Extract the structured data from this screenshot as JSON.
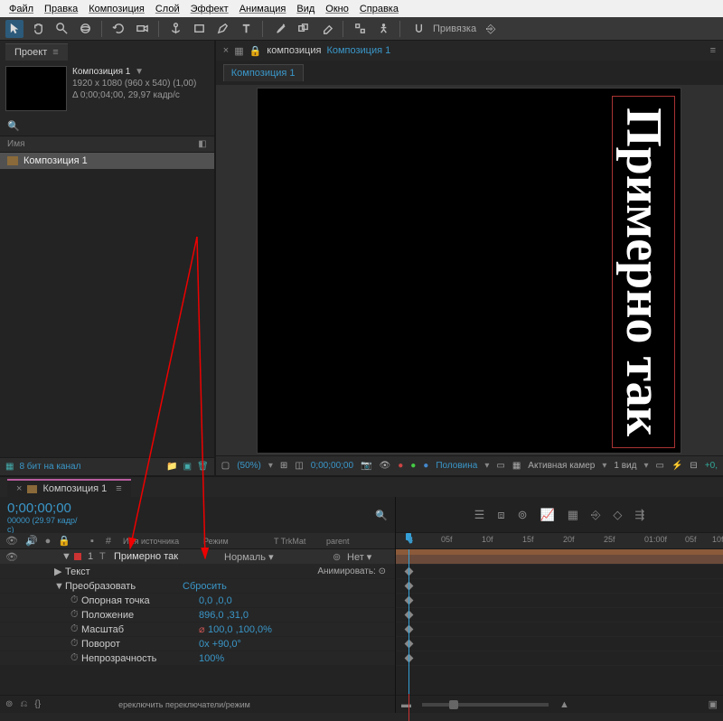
{
  "menu": [
    "Файл",
    "Правка",
    "Композиция",
    "Слой",
    "Эффект",
    "Анимация",
    "Вид",
    "Окно",
    "Справка"
  ],
  "toolbar_snap_label": "Привязка",
  "project": {
    "tab_label": "Проект",
    "comp_name": "Композиция 1",
    "comp_dims": "1920 x 1080  (960 x 540) (1,00)",
    "comp_dur": "Δ 0;00;04;00, 29,97 кадр/с",
    "name_header": "Имя",
    "items": [
      "Композиция 1"
    ],
    "footer_bits": "8 бит на канал"
  },
  "viewer": {
    "nav_label_crumb": "композиция",
    "nav_label_active": "Композиция 1",
    "subtab": "Композиция 1",
    "canvas_text": "Примерно так",
    "status": {
      "zoom": "(50%)",
      "time": "0;00;00;00",
      "res": "Половина",
      "cam": "Активная камер",
      "view": "1 вид"
    }
  },
  "timeline": {
    "tab_label": "Композиция 1",
    "time": "0;00;00;00",
    "frame_info": "00000 (29.97 кадр/с)",
    "col_idx": "#",
    "col_name": "Имя источника",
    "col_mode": "Режим",
    "col_trk": "T  TrkMat",
    "col_par": "parent",
    "layer": {
      "index": "1",
      "name": "Примерно так",
      "mode": "Нормаль",
      "parent": "Нет"
    },
    "text_group": "Текст",
    "animate_label": "Анимировать:",
    "transform_group": "Преобразовать",
    "transform_reset": "Сбросить",
    "props": [
      {
        "name": "Опорная точка",
        "val": "0,0 ,0,0"
      },
      {
        "name": "Положение",
        "val": "896,0 ,31,0"
      },
      {
        "name": "Масштаб",
        "val": "100,0 ,100,0%",
        "link": true
      },
      {
        "name": "Поворот",
        "val": "0x +90,0°"
      },
      {
        "name": "Непрозрачность",
        "val": "100%"
      }
    ],
    "switches_label": "ереключить переключатели/режим",
    "ruler_ticks": [
      "05f",
      "10f",
      "15f",
      "20f",
      "25f",
      "01:00f",
      "05f",
      "10f"
    ]
  }
}
